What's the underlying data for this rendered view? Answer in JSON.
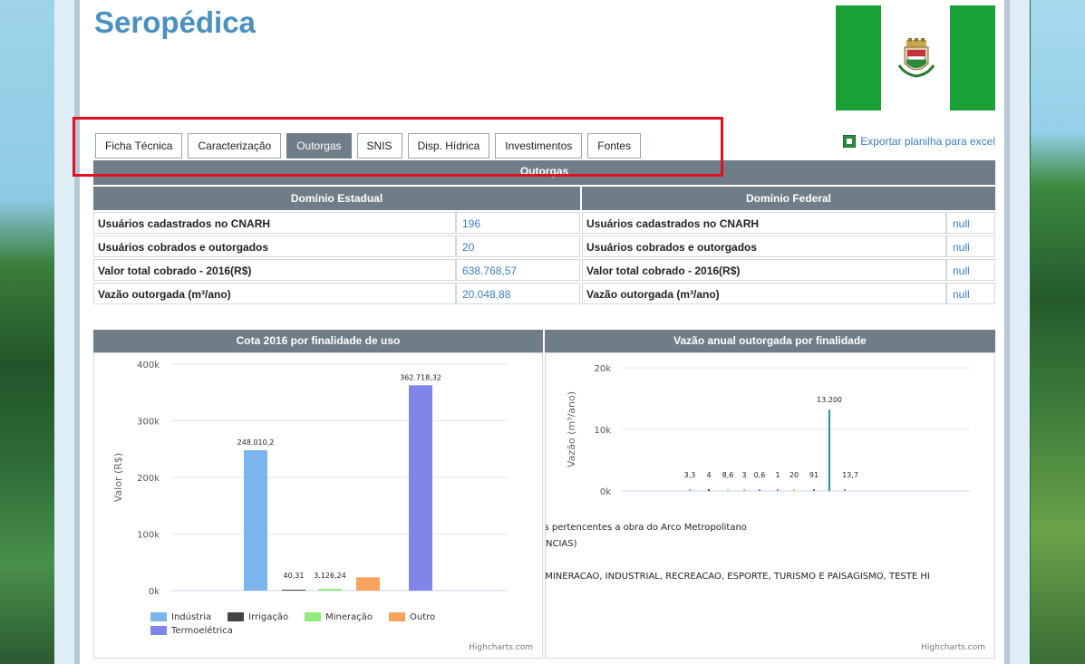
{
  "header": {
    "city": "Seropédica"
  },
  "tabs": [
    "Ficha Técnica",
    "Caracterização",
    "Outorgas",
    "SNIS",
    "Disp. Hídrica",
    "Investimentos",
    "Fontes"
  ],
  "active_tab": "Outorgas",
  "export_label": "Exportar planilha para excel",
  "outorgas": {
    "title": "Outorgas",
    "estadual": {
      "title": "Domínio Estadual",
      "rows": [
        {
          "label": "Usuários cadastrados no CNARH",
          "value": "196"
        },
        {
          "label": "Usuários cobrados e outorgados",
          "value": "20"
        },
        {
          "label": "Valor total cobrado - 2016(R$)",
          "value": "638.768,57"
        },
        {
          "label": "Vazão outorgada (m³/ano)",
          "value": "20.048,88"
        }
      ]
    },
    "federal": {
      "title": "Domínio Federal",
      "rows": [
        {
          "label": "Usuários cadastrados no CNARH",
          "value": "null"
        },
        {
          "label": "Usuários cobrados e outorgados",
          "value": "null"
        },
        {
          "label": "Valor total cobrado - 2016(R$)",
          "value": "null"
        },
        {
          "label": "Vazão outorgada (m³/ano)",
          "value": "null"
        }
      ]
    }
  },
  "charts": {
    "left_title": "Cota 2016 por finalidade de uso",
    "right_title": "Vazão anual outorgada por finalidade",
    "credit": "Highcharts.com",
    "notes": [
      "nas pertencentes a obra do Arco Metropolitano",
      "DENCIAS)",
      "A, MINERACAO, INDUSTRIAL, RECREACAO, ESPORTE, TURISMO E PAISAGISMO, TESTE HI"
    ]
  },
  "colors": {
    "header_bar": "#6f7d88",
    "link": "#3a7fc0",
    "title": "#4a90c0",
    "highlight": "#e0101e"
  },
  "chart_data": [
    {
      "type": "bar",
      "title": "Cota 2016 por finalidade de uso",
      "ylabel": "Valor (R$)",
      "ylim": [
        0,
        400000
      ],
      "yticks": [
        "0k",
        "100k",
        "200k",
        "300k",
        "400k"
      ],
      "series": [
        {
          "name": "Indústria",
          "color": "#7cb5ec",
          "value": 248010.2,
          "label": "248.010,2"
        },
        {
          "name": "Irrigação",
          "color": "#434348",
          "value": 40.31,
          "label": "40,31"
        },
        {
          "name": "Mineração",
          "color": "#90ed7d",
          "value": 3126.24,
          "label": "3.126,24"
        },
        {
          "name": "Outro",
          "color": "#f7a35c",
          "value": 23500,
          "label": ""
        },
        {
          "name": "Termoelétrica",
          "color": "#8085e9",
          "value": 362718.32,
          "label": "362.718,32"
        }
      ],
      "legend": "bottom"
    },
    {
      "type": "bar",
      "title": "Vazão anual outorgada por finalidade",
      "ylabel": "Vazão (m³/ano)",
      "ylim": [
        0,
        20000
      ],
      "yticks": [
        "0k",
        "10k",
        "20k"
      ],
      "values": [
        3.3,
        4,
        8.6,
        3,
        0.6,
        1,
        20,
        91,
        13200,
        13.7
      ],
      "labels": [
        "3,3",
        "4",
        "8,6",
        "3",
        "0,6",
        "1",
        "20",
        "91",
        "13.200",
        "13,7"
      ],
      "colors": [
        "#7cb5ec",
        "#434348",
        "#90ed7d",
        "#f7a35c",
        "#8085e9",
        "#f15c80",
        "#e4d354",
        "#2b908f",
        "#2b908f",
        "#8085e9"
      ]
    }
  ]
}
